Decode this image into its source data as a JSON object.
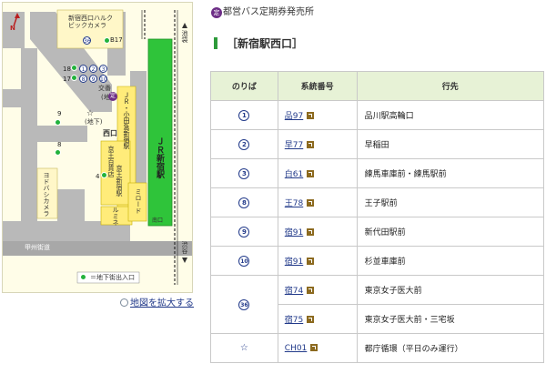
{
  "header": {
    "icon": "定",
    "title": "都営バス定期券発売所"
  },
  "section": {
    "title": "［新宿駅西口］"
  },
  "map": {
    "north": "N",
    "building_top": "新宿西口ハルク\nビックカメラ",
    "to_ikebukuro": "池袋",
    "to_shibuya": "渋谷",
    "odakyu": "小田急新宿駅",
    "jr_label": "JR新宿駅",
    "odakyu_short": "JR",
    "nishiguchi": "西口",
    "keio": "京王百貨店",
    "keio_station": "京王新宿駅",
    "mylord": "ミロード",
    "lumine": "ルミネ",
    "minamiguchi": "南口",
    "yodobashi": "ヨドバシカメラ",
    "koban": "交番",
    "underground": "地下",
    "koshu": "甲州街道",
    "legend": "＝地下街出入口",
    "stop_labels": [
      "18",
      "17",
      "9",
      "8",
      "4",
      "B17"
    ],
    "stop_circles_row1": [
      "①",
      "②",
      "③"
    ],
    "stop_circles_row2": [
      "⑧",
      "⑨",
      "⑩"
    ],
    "stop_36": "㊱"
  },
  "enlarge_link": "地図を拡大する",
  "table": {
    "headers": [
      "のりば",
      "系統番号",
      "行先"
    ],
    "rows": [
      {
        "stop": "1",
        "route": "品97",
        "dest": "品川駅高輪口"
      },
      {
        "stop": "2",
        "route": "早77",
        "dest": "早稲田"
      },
      {
        "stop": "3",
        "route": "白61",
        "dest": "練馬車庫前・練馬駅前"
      },
      {
        "stop": "8",
        "route": "王78",
        "dest": "王子駅前"
      },
      {
        "stop": "9",
        "route": "宿91",
        "dest": "新代田駅前"
      },
      {
        "stop": "10",
        "route": "宿91",
        "dest": "杉並車庫前"
      },
      {
        "stop": "36",
        "route": "宿74",
        "dest": "東京女子医大前"
      },
      {
        "stop": "",
        "route": "宿75",
        "dest": "東京女子医大前・三宅坂"
      },
      {
        "stop": "☆",
        "route": "CH01",
        "dest": "都庁循環（平日のみ運行）"
      }
    ]
  }
}
